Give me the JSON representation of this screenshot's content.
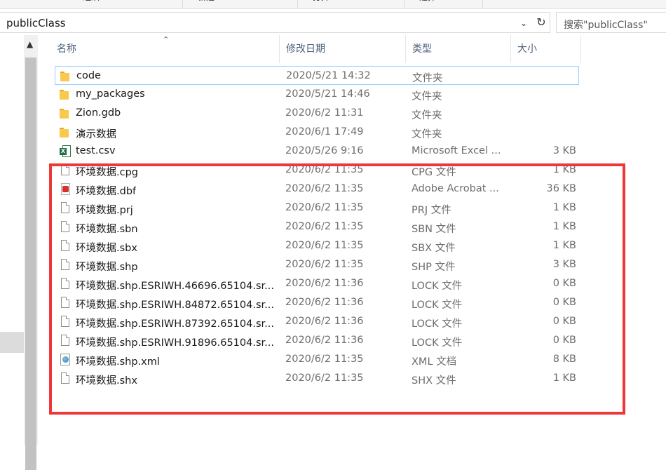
{
  "ribbon": {
    "items": [
      "组织",
      "新建",
      "打开",
      "选择"
    ]
  },
  "address": {
    "path": "publicClass",
    "dropdown": "chevron-down-icon",
    "refresh": "refresh-icon"
  },
  "search": {
    "placeholder": "搜索\"publicClass\""
  },
  "columns": {
    "name": "名称",
    "date": "修改日期",
    "type": "类型",
    "size": "大小"
  },
  "files": [
    {
      "name": "code",
      "date": "2020/5/21 14:32",
      "type": "文件夹",
      "size": "",
      "icon": "folder-icon"
    },
    {
      "name": "my_packages",
      "date": "2020/5/21 14:46",
      "type": "文件夹",
      "size": "",
      "icon": "folder-icon"
    },
    {
      "name": "Zion.gdb",
      "date": "2020/6/2 11:31",
      "type": "文件夹",
      "size": "",
      "icon": "folder-icon"
    },
    {
      "name": "演示数据",
      "date": "2020/6/1 17:49",
      "type": "文件夹",
      "size": "",
      "icon": "folder-icon"
    },
    {
      "name": "test.csv",
      "date": "2020/5/26 9:16",
      "type": "Microsoft Excel ...",
      "size": "3 KB",
      "icon": "excel-icon"
    },
    {
      "name": "环境数据.cpg",
      "date": "2020/6/2 11:35",
      "type": "CPG 文件",
      "size": "1 KB",
      "icon": "file-icon"
    },
    {
      "name": "环境数据.dbf",
      "date": "2020/6/2 11:35",
      "type": "Adobe Acrobat ...",
      "size": "36 KB",
      "icon": "pdf-icon"
    },
    {
      "name": "环境数据.prj",
      "date": "2020/6/2 11:35",
      "type": "PRJ 文件",
      "size": "1 KB",
      "icon": "file-icon"
    },
    {
      "name": "环境数据.sbn",
      "date": "2020/6/2 11:35",
      "type": "SBN 文件",
      "size": "1 KB",
      "icon": "file-icon"
    },
    {
      "name": "环境数据.sbx",
      "date": "2020/6/2 11:35",
      "type": "SBX 文件",
      "size": "1 KB",
      "icon": "file-icon"
    },
    {
      "name": "环境数据.shp",
      "date": "2020/6/2 11:35",
      "type": "SHP 文件",
      "size": "3 KB",
      "icon": "file-icon"
    },
    {
      "name": "环境数据.shp.ESRIWH.46696.65104.sr...",
      "date": "2020/6/2 11:36",
      "type": "LOCK 文件",
      "size": "0 KB",
      "icon": "file-icon"
    },
    {
      "name": "环境数据.shp.ESRIWH.84872.65104.sr...",
      "date": "2020/6/2 11:36",
      "type": "LOCK 文件",
      "size": "0 KB",
      "icon": "file-icon"
    },
    {
      "name": "环境数据.shp.ESRIWH.87392.65104.sr...",
      "date": "2020/6/2 11:36",
      "type": "LOCK 文件",
      "size": "0 KB",
      "icon": "file-icon"
    },
    {
      "name": "环境数据.shp.ESRIWH.91896.65104.sr...",
      "date": "2020/6/2 11:36",
      "type": "LOCK 文件",
      "size": "0 KB",
      "icon": "file-icon"
    },
    {
      "name": "环境数据.shp.xml",
      "date": "2020/6/2 11:35",
      "type": "XML 文档",
      "size": "8 KB",
      "icon": "xml-icon"
    },
    {
      "name": "环境数据.shx",
      "date": "2020/6/2 11:35",
      "type": "SHX 文件",
      "size": "1 KB",
      "icon": "file-icon"
    }
  ],
  "highlight_color": "#f03737",
  "selection_color": "#99d1ff"
}
